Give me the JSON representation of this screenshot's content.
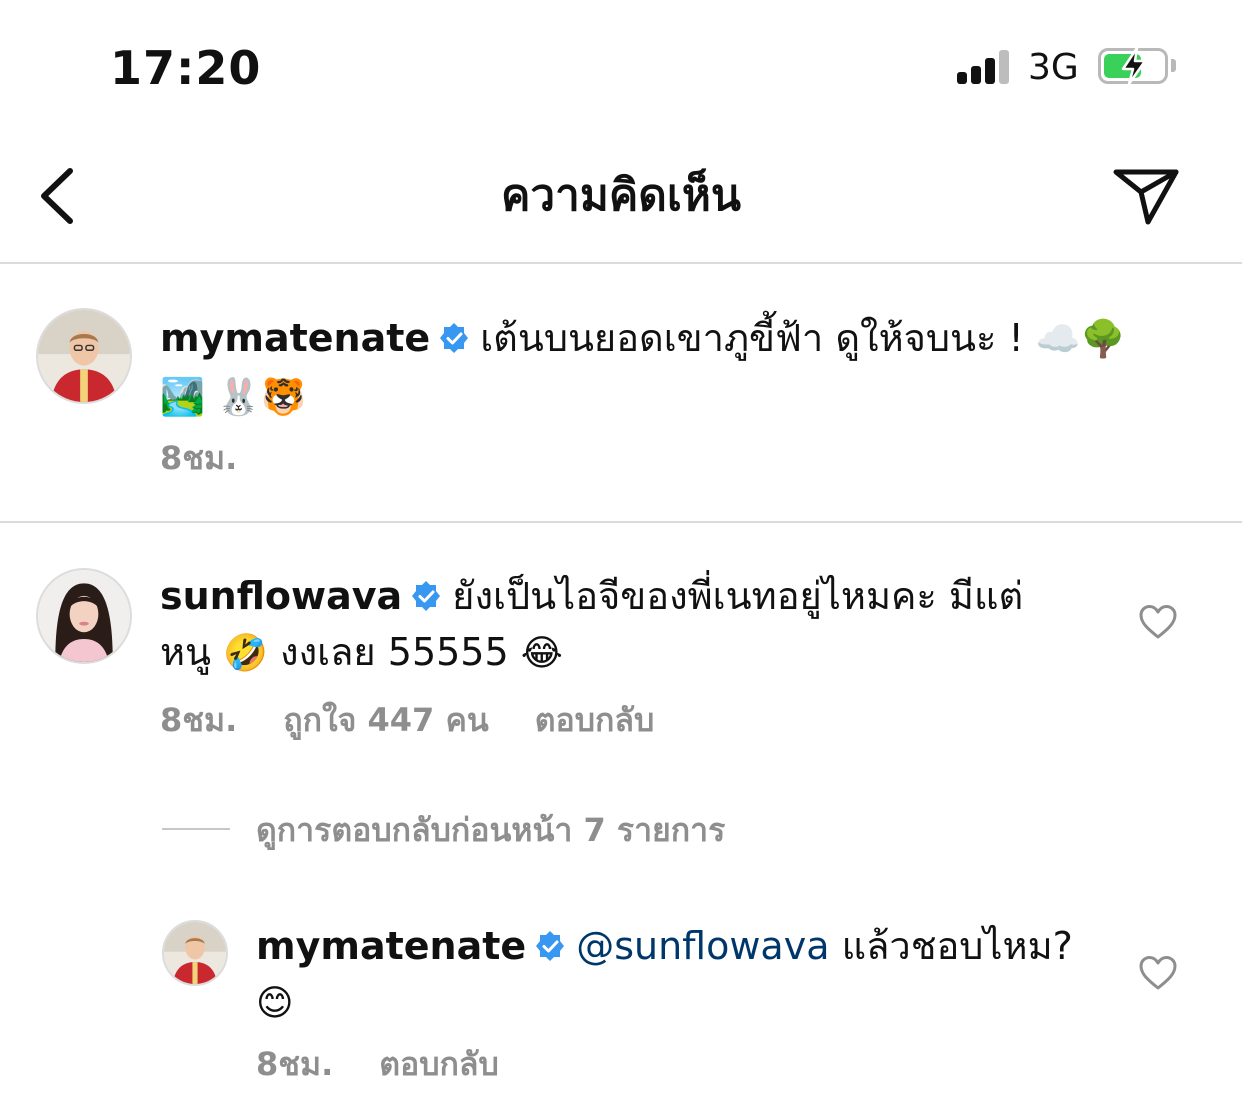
{
  "status_bar": {
    "time": "17:20",
    "network": "3G",
    "battery_charging": true
  },
  "header": {
    "title": "ความคิดเห็น",
    "back_icon": "chevron-left-icon",
    "send_icon": "send-icon"
  },
  "caption": {
    "username": "mymatenate",
    "text": "เต้นบนยอดเขาภูขี้ฟ้า ดูให้จบนะ !",
    "emojis_line1": "☁️🌳",
    "emojis_line2": "🏞️ 🐰🐯",
    "time": "8ชม."
  },
  "comment": {
    "username": "sunflowava",
    "text_line1": "ยังเป็นไอจีของพี่เนทอยู่ไหมคะ มีแต่",
    "text_line2_a": "หนู",
    "emoji_a": "🤣",
    "text_line2_b": "งงเลย 55555",
    "emoji_b": "😂",
    "time": "8ชม.",
    "likes": "ถูกใจ 447 คน",
    "reply": "ตอบกลับ"
  },
  "view_replies": "ดูการตอบกลับก่อนหน้า 7 รายการ",
  "reply": {
    "username": "mymatenate",
    "mention": "@sunflowava",
    "text": "แล้วชอบไหม?",
    "emoji": "😊",
    "time": "8ชม.",
    "reply": "ตอบกลับ"
  },
  "colors": {
    "verified": "#3897f0",
    "meta": "#8e8e8e",
    "mention": "#00376b",
    "battery": "#3ad15a"
  }
}
